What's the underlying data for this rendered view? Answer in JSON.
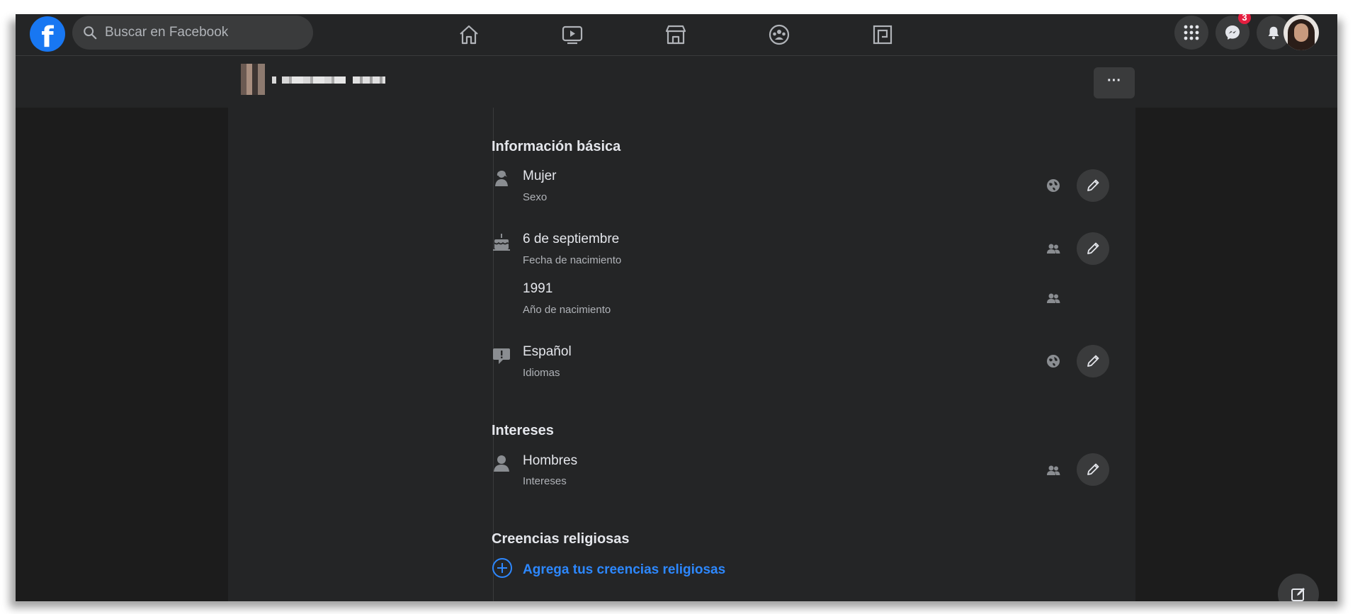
{
  "topbar": {
    "search_placeholder": "Buscar en Facebook",
    "messenger_badge": "3",
    "logo_letter": "f"
  },
  "subbar": {
    "more_label": "···"
  },
  "basic_info": {
    "title": "Información básica",
    "items": [
      {
        "value": "Mujer",
        "label": "Sexo",
        "icon": "gender-icon",
        "privacy": "public-globe-icon"
      },
      {
        "value": "6 de septiembre",
        "label": "Fecha de nacimiento",
        "icon": "birthday-cake-icon",
        "privacy": "friends-icon"
      },
      {
        "value": "1991",
        "label": "Año de nacimiento",
        "icon": "",
        "privacy": "friends-icon"
      },
      {
        "value": "Español",
        "label": "Idiomas",
        "icon": "language-bubble-icon",
        "privacy": "public-globe-icon"
      }
    ]
  },
  "interests": {
    "title": "Intereses",
    "items": [
      {
        "value": "Hombres",
        "label": "Intereses",
        "icon": "person-icon",
        "privacy": "friends-icon"
      }
    ]
  },
  "religion": {
    "title": "Creencias religiosas",
    "add_label": "Agrega tus creencias religiosas"
  },
  "colors": {
    "accent": "#2d88ff",
    "brand": "#1877f2",
    "badge": "#e41e3f",
    "surface": "#242526"
  }
}
